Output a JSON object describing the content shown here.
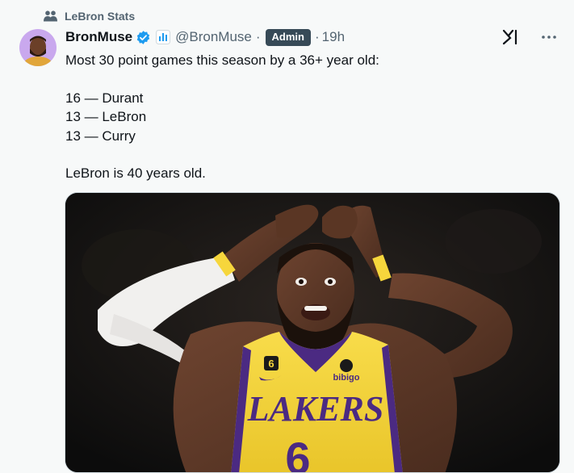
{
  "context": {
    "label": "LeBron Stats",
    "icon": "people-icon"
  },
  "author": {
    "name": "BronMuse",
    "handle": "@BronMuse",
    "badge": "Admin",
    "time": "19h",
    "verified": true
  },
  "tweet": {
    "lines": [
      "Most 30 point games this season by a 36+ year old:",
      "",
      "16 — Durant",
      "13 — LeBron",
      "13 — Curry",
      "",
      "LeBron is 40 years old."
    ]
  },
  "media": {
    "jersey_text": "LAKERS",
    "jersey_number": "6",
    "chest_number": "6",
    "sponsor": "bibigo"
  },
  "colors": {
    "verified_blue": "#1d9bf0",
    "badge_bg": "#374a57",
    "secondary_text": "#536471",
    "lakers_gold": "#f6d63c",
    "lakers_purple": "#4b2a82"
  }
}
